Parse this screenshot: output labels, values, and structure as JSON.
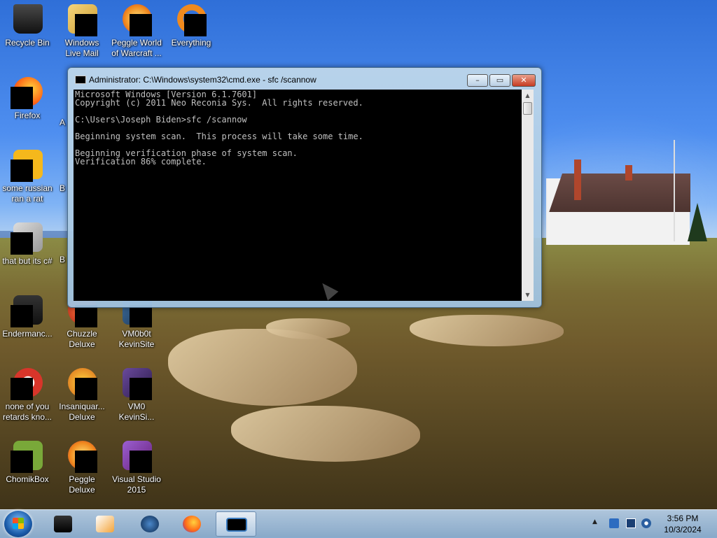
{
  "desktop": {
    "icons": [
      {
        "label": "Recycle Bin"
      },
      {
        "label": "Windows Live Mail"
      },
      {
        "label": "Peggle World of Warcraft ..."
      },
      {
        "label": "Everything"
      },
      {
        "label": "Firefox"
      },
      {
        "label": "A"
      },
      {
        "label": "some russian ran a rat"
      },
      {
        "label": "B"
      },
      {
        "label": "that but its c#"
      },
      {
        "label": "B"
      },
      {
        "label": "Endermanc..."
      },
      {
        "label": "Chuzzle Deluxe"
      },
      {
        "label": "VM0b0t KevinSite"
      },
      {
        "label": "none of you retards kno..."
      },
      {
        "label": "Insaniquar... Deluxe"
      },
      {
        "label": "VM0 KevinSi..."
      },
      {
        "label": "ChomikBox"
      },
      {
        "label": "Peggle Deluxe"
      },
      {
        "label": "Visual Studio 2015"
      }
    ]
  },
  "cmd_window": {
    "title": "Administrator: C:\\Windows\\system32\\cmd.exe - sfc  /scannow",
    "buttons": {
      "minimize": "–",
      "maximize": "▭",
      "close": "✕"
    },
    "lines": [
      "Microsoft Windows [Version 6.1.7601]",
      "Copyright (c) 2011 Neo Reconia Sys.  All rights reserved.",
      "",
      "C:\\Users\\Joseph Biden>sfc /scannow",
      "",
      "Beginning system scan.  This process will take some time.",
      "",
      "Beginning verification phase of system scan.",
      "Verification 86% complete."
    ]
  },
  "taskbar": {
    "clock_time": "3:56 PM",
    "clock_date": "10/3/2024",
    "tray_chevron": "▲"
  }
}
